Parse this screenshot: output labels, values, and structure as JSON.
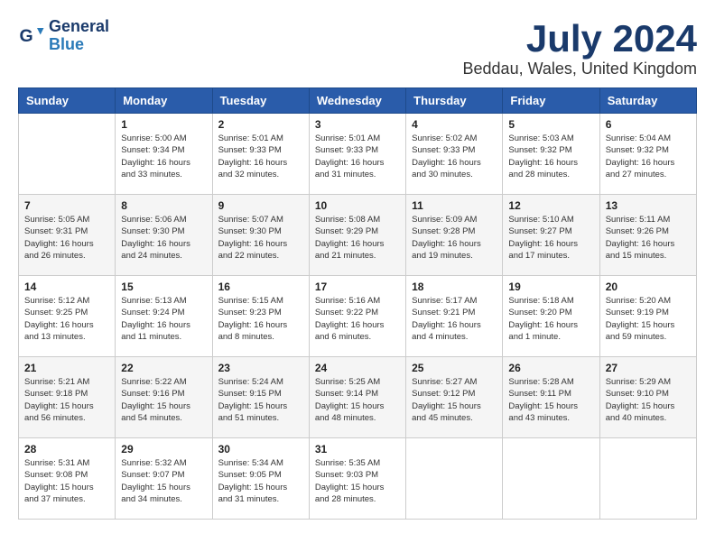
{
  "header": {
    "logo_general": "General",
    "logo_blue": "Blue",
    "month_year": "July 2024",
    "location": "Beddau, Wales, United Kingdom"
  },
  "calendar": {
    "days_of_week": [
      "Sunday",
      "Monday",
      "Tuesday",
      "Wednesday",
      "Thursday",
      "Friday",
      "Saturday"
    ],
    "weeks": [
      [
        {
          "day": "",
          "info": ""
        },
        {
          "day": "1",
          "info": "Sunrise: 5:00 AM\nSunset: 9:34 PM\nDaylight: 16 hours\nand 33 minutes."
        },
        {
          "day": "2",
          "info": "Sunrise: 5:01 AM\nSunset: 9:33 PM\nDaylight: 16 hours\nand 32 minutes."
        },
        {
          "day": "3",
          "info": "Sunrise: 5:01 AM\nSunset: 9:33 PM\nDaylight: 16 hours\nand 31 minutes."
        },
        {
          "day": "4",
          "info": "Sunrise: 5:02 AM\nSunset: 9:33 PM\nDaylight: 16 hours\nand 30 minutes."
        },
        {
          "day": "5",
          "info": "Sunrise: 5:03 AM\nSunset: 9:32 PM\nDaylight: 16 hours\nand 28 minutes."
        },
        {
          "day": "6",
          "info": "Sunrise: 5:04 AM\nSunset: 9:32 PM\nDaylight: 16 hours\nand 27 minutes."
        }
      ],
      [
        {
          "day": "7",
          "info": "Sunrise: 5:05 AM\nSunset: 9:31 PM\nDaylight: 16 hours\nand 26 minutes."
        },
        {
          "day": "8",
          "info": "Sunrise: 5:06 AM\nSunset: 9:30 PM\nDaylight: 16 hours\nand 24 minutes."
        },
        {
          "day": "9",
          "info": "Sunrise: 5:07 AM\nSunset: 9:30 PM\nDaylight: 16 hours\nand 22 minutes."
        },
        {
          "day": "10",
          "info": "Sunrise: 5:08 AM\nSunset: 9:29 PM\nDaylight: 16 hours\nand 21 minutes."
        },
        {
          "day": "11",
          "info": "Sunrise: 5:09 AM\nSunset: 9:28 PM\nDaylight: 16 hours\nand 19 minutes."
        },
        {
          "day": "12",
          "info": "Sunrise: 5:10 AM\nSunset: 9:27 PM\nDaylight: 16 hours\nand 17 minutes."
        },
        {
          "day": "13",
          "info": "Sunrise: 5:11 AM\nSunset: 9:26 PM\nDaylight: 16 hours\nand 15 minutes."
        }
      ],
      [
        {
          "day": "14",
          "info": "Sunrise: 5:12 AM\nSunset: 9:25 PM\nDaylight: 16 hours\nand 13 minutes."
        },
        {
          "day": "15",
          "info": "Sunrise: 5:13 AM\nSunset: 9:24 PM\nDaylight: 16 hours\nand 11 minutes."
        },
        {
          "day": "16",
          "info": "Sunrise: 5:15 AM\nSunset: 9:23 PM\nDaylight: 16 hours\nand 8 minutes."
        },
        {
          "day": "17",
          "info": "Sunrise: 5:16 AM\nSunset: 9:22 PM\nDaylight: 16 hours\nand 6 minutes."
        },
        {
          "day": "18",
          "info": "Sunrise: 5:17 AM\nSunset: 9:21 PM\nDaylight: 16 hours\nand 4 minutes."
        },
        {
          "day": "19",
          "info": "Sunrise: 5:18 AM\nSunset: 9:20 PM\nDaylight: 16 hours\nand 1 minute."
        },
        {
          "day": "20",
          "info": "Sunrise: 5:20 AM\nSunset: 9:19 PM\nDaylight: 15 hours\nand 59 minutes."
        }
      ],
      [
        {
          "day": "21",
          "info": "Sunrise: 5:21 AM\nSunset: 9:18 PM\nDaylight: 15 hours\nand 56 minutes."
        },
        {
          "day": "22",
          "info": "Sunrise: 5:22 AM\nSunset: 9:16 PM\nDaylight: 15 hours\nand 54 minutes."
        },
        {
          "day": "23",
          "info": "Sunrise: 5:24 AM\nSunset: 9:15 PM\nDaylight: 15 hours\nand 51 minutes."
        },
        {
          "day": "24",
          "info": "Sunrise: 5:25 AM\nSunset: 9:14 PM\nDaylight: 15 hours\nand 48 minutes."
        },
        {
          "day": "25",
          "info": "Sunrise: 5:27 AM\nSunset: 9:12 PM\nDaylight: 15 hours\nand 45 minutes."
        },
        {
          "day": "26",
          "info": "Sunrise: 5:28 AM\nSunset: 9:11 PM\nDaylight: 15 hours\nand 43 minutes."
        },
        {
          "day": "27",
          "info": "Sunrise: 5:29 AM\nSunset: 9:10 PM\nDaylight: 15 hours\nand 40 minutes."
        }
      ],
      [
        {
          "day": "28",
          "info": "Sunrise: 5:31 AM\nSunset: 9:08 PM\nDaylight: 15 hours\nand 37 minutes."
        },
        {
          "day": "29",
          "info": "Sunrise: 5:32 AM\nSunset: 9:07 PM\nDaylight: 15 hours\nand 34 minutes."
        },
        {
          "day": "30",
          "info": "Sunrise: 5:34 AM\nSunset: 9:05 PM\nDaylight: 15 hours\nand 31 minutes."
        },
        {
          "day": "31",
          "info": "Sunrise: 5:35 AM\nSunset: 9:03 PM\nDaylight: 15 hours\nand 28 minutes."
        },
        {
          "day": "",
          "info": ""
        },
        {
          "day": "",
          "info": ""
        },
        {
          "day": "",
          "info": ""
        }
      ]
    ]
  }
}
